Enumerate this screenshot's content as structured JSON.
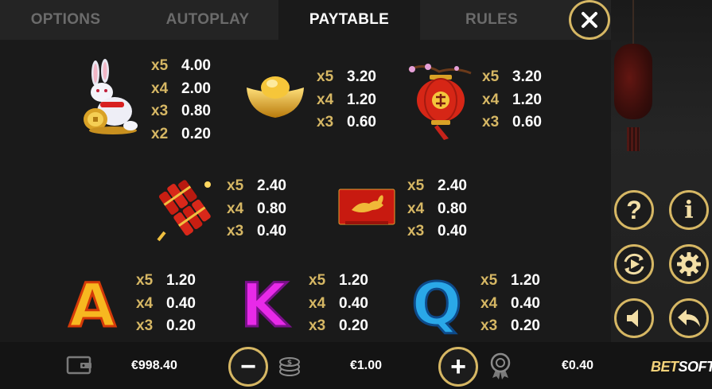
{
  "tabs": [
    {
      "label": "OPTIONS",
      "active": false
    },
    {
      "label": "AUTOPLAY",
      "active": false
    },
    {
      "label": "PAYTABLE",
      "active": true
    },
    {
      "label": "RULES",
      "active": false
    }
  ],
  "close_icon": "close-icon",
  "paytable": {
    "rabbit": [
      {
        "mult": "x5",
        "value": "4.00"
      },
      {
        "mult": "x4",
        "value": "2.00"
      },
      {
        "mult": "x3",
        "value": "0.80"
      },
      {
        "mult": "x2",
        "value": "0.20"
      }
    ],
    "gold_ingot": [
      {
        "mult": "x5",
        "value": "3.20"
      },
      {
        "mult": "x4",
        "value": "1.20"
      },
      {
        "mult": "x3",
        "value": "0.60"
      }
    ],
    "lantern": [
      {
        "mult": "x5",
        "value": "3.20"
      },
      {
        "mult": "x4",
        "value": "1.20"
      },
      {
        "mult": "x3",
        "value": "0.60"
      }
    ],
    "firecrackers": [
      {
        "mult": "x5",
        "value": "2.40"
      },
      {
        "mult": "x4",
        "value": "0.80"
      },
      {
        "mult": "x3",
        "value": "0.40"
      }
    ],
    "envelope": [
      {
        "mult": "x5",
        "value": "2.40"
      },
      {
        "mult": "x4",
        "value": "0.80"
      },
      {
        "mult": "x3",
        "value": "0.40"
      }
    ],
    "letter_a": [
      {
        "mult": "x5",
        "value": "1.20"
      },
      {
        "mult": "x4",
        "value": "0.40"
      },
      {
        "mult": "x3",
        "value": "0.20"
      }
    ],
    "letter_k": [
      {
        "mult": "x5",
        "value": "1.20"
      },
      {
        "mult": "x4",
        "value": "0.40"
      },
      {
        "mult": "x3",
        "value": "0.20"
      }
    ],
    "letter_q": [
      {
        "mult": "x5",
        "value": "1.20"
      },
      {
        "mult": "x4",
        "value": "0.40"
      },
      {
        "mult": "x3",
        "value": "0.20"
      }
    ]
  },
  "symbols": {
    "letter_a": "A",
    "letter_k": "K",
    "letter_q": "Q"
  },
  "side_controls": {
    "help": "?",
    "info": "i",
    "autoplay_icon": "autoplay-icon",
    "settings_icon": "gear-icon",
    "sound_icon": "speaker-icon",
    "back_icon": "back-arrow-icon"
  },
  "bottom": {
    "balance": "€998.40",
    "bet": "€1.00",
    "win": "€0.40",
    "minus": "−",
    "plus": "+",
    "logo_part1": "BET",
    "logo_part2": "SOFT"
  },
  "colors": {
    "gold_accent": "#d6b764",
    "background": "#1a1a1a",
    "text": "#ffffff"
  }
}
